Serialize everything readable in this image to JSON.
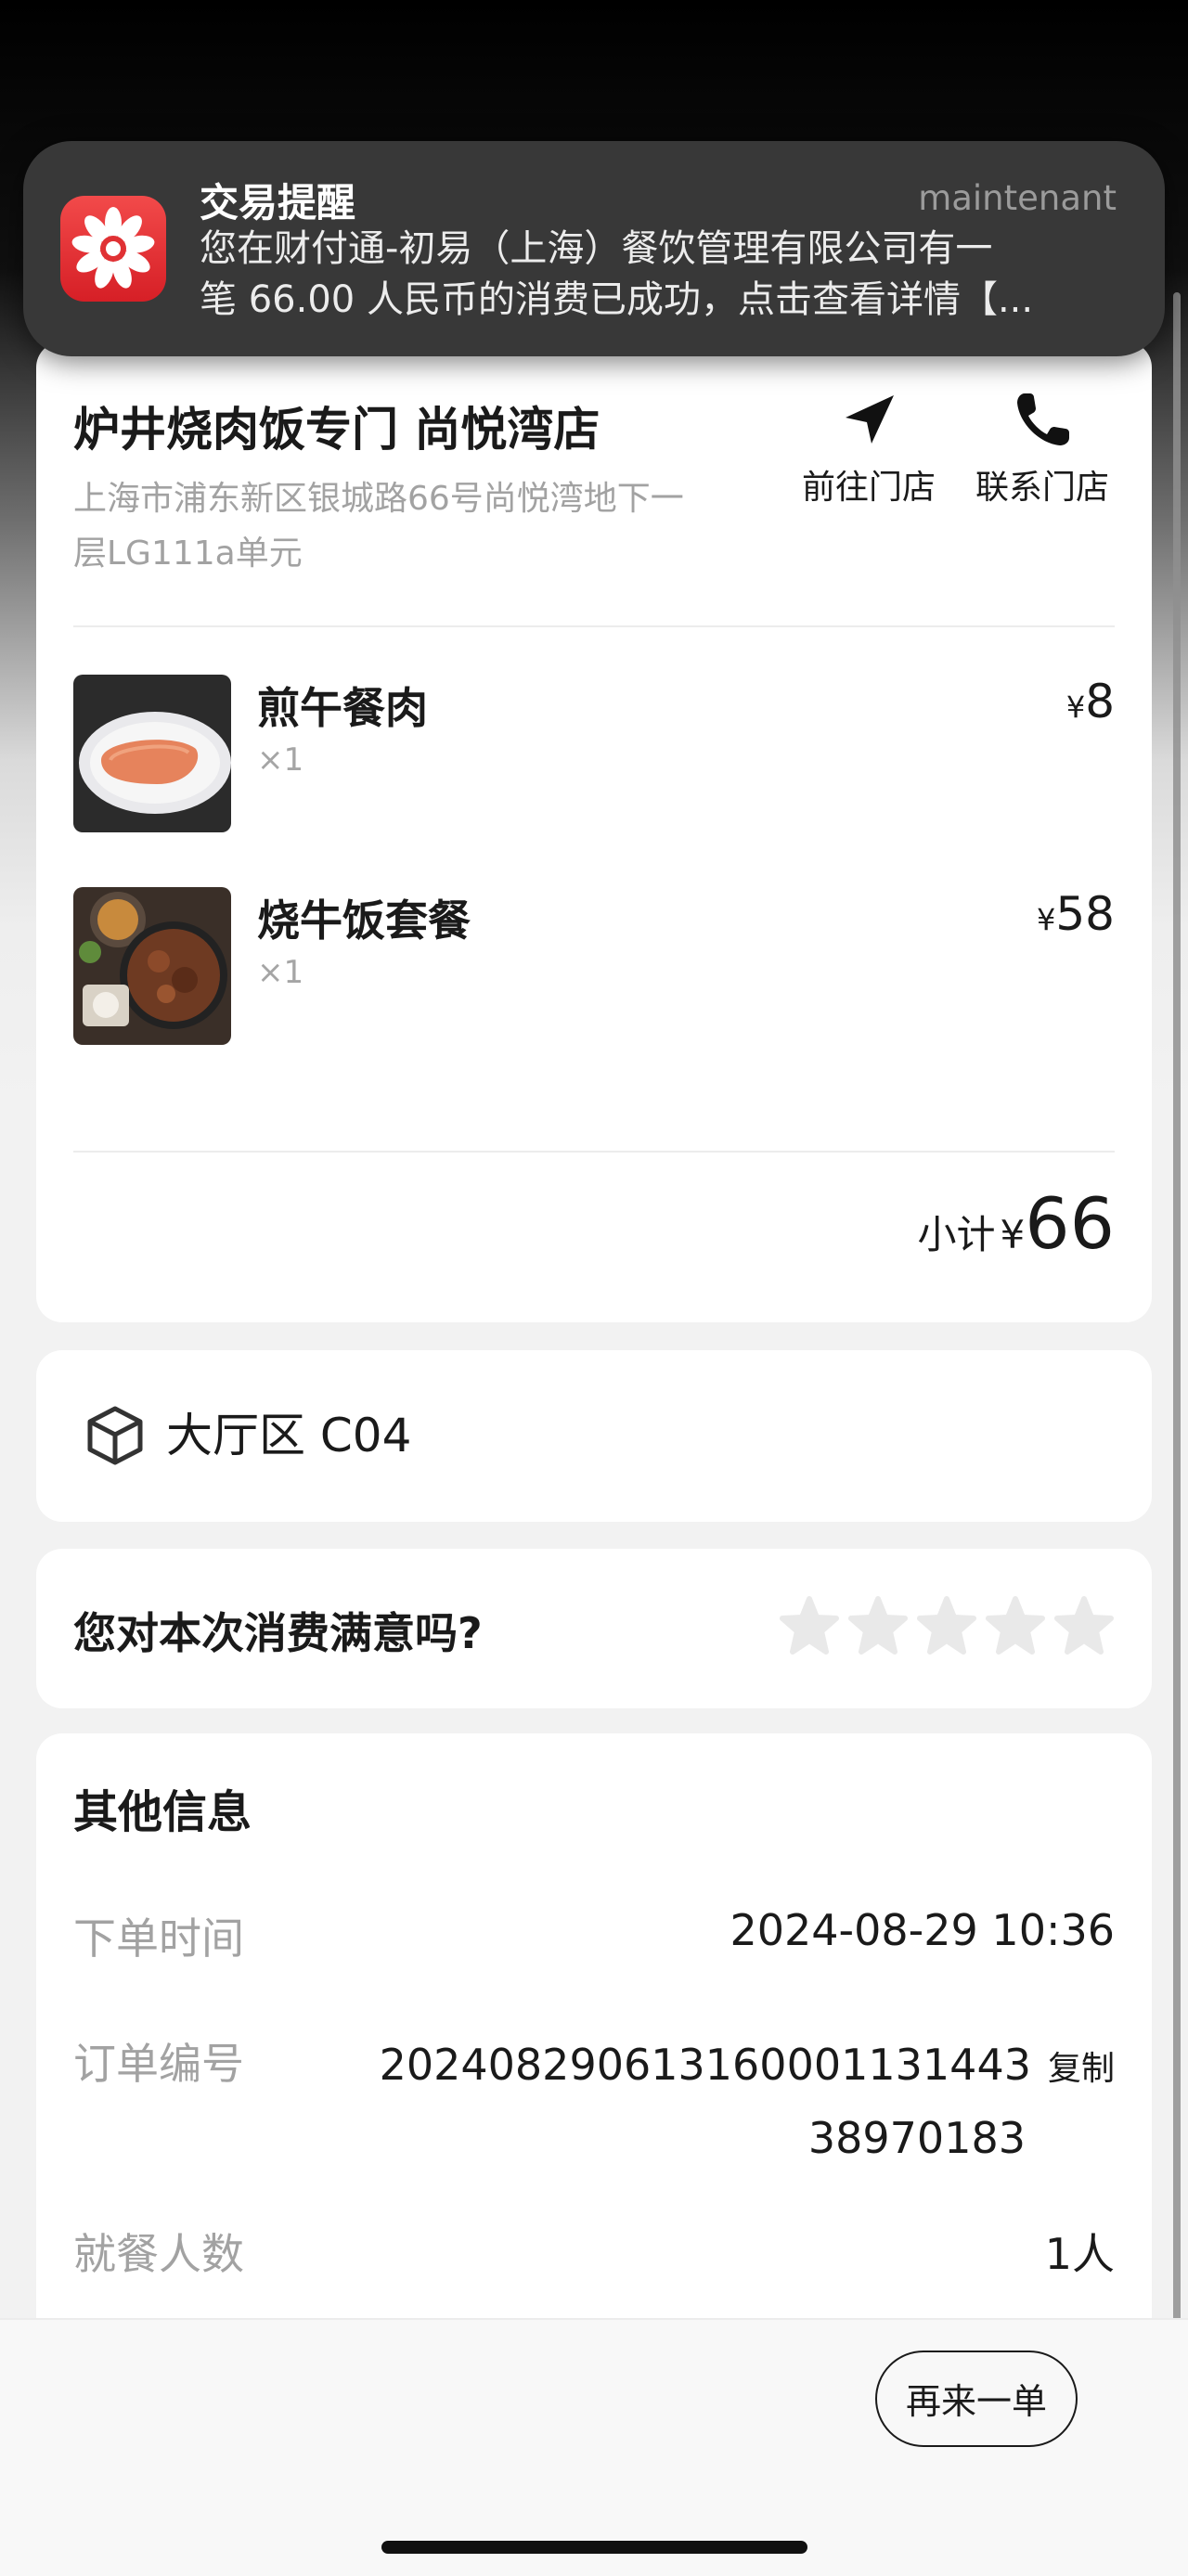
{
  "notification": {
    "app_icon": "flower-logo-icon",
    "title": "交易提醒",
    "time": "maintenant",
    "body_line1": "您在财付通-初易（上海）餐饮管理有限公司有一",
    "body_line2": "笔 66.00 人民币的消费已成功，点击查看详情【..."
  },
  "store": {
    "name": "炉井烧肉饭专门 尚悦湾店",
    "address_line1": "上海市浦东新区银城路66号尚悦湾地下一",
    "address_line2": "层LG111a单元",
    "actions": [
      {
        "label": "前往门店",
        "icon": "navigation-arrow-icon"
      },
      {
        "label": "联系门店",
        "icon": "phone-icon"
      }
    ]
  },
  "items": [
    {
      "name": "煎午餐肉",
      "qty": "×1",
      "currency": "¥",
      "price": "8"
    },
    {
      "name": "烧牛饭套餐",
      "qty": "×1",
      "currency": "¥",
      "price": "58"
    }
  ],
  "subtotal": {
    "label": "小计",
    "currency": "¥",
    "amount": "66"
  },
  "table": {
    "icon": "cube-icon",
    "text": "大厅区 C04"
  },
  "rating": {
    "question": "您对本次消费满意吗?",
    "stars_total": 5,
    "stars_selected": 0
  },
  "info": {
    "title": "其他信息",
    "order_time_label": "下单时间",
    "order_time": "2024-08-29 10:36",
    "order_no_label": "订单编号",
    "order_no_line1": "20240829061316000113144З",
    "order_no_line2": "38970183",
    "copy_label": "复制",
    "diners_label": "就餐人数",
    "diners": "1人"
  },
  "footer": {
    "reorder_label": "再来一单"
  },
  "colors": {
    "text": "#1a1a1a",
    "muted": "#a2a2a2",
    "card": "#ffffff",
    "page": "#f2f2f2",
    "notification": "#383838"
  }
}
